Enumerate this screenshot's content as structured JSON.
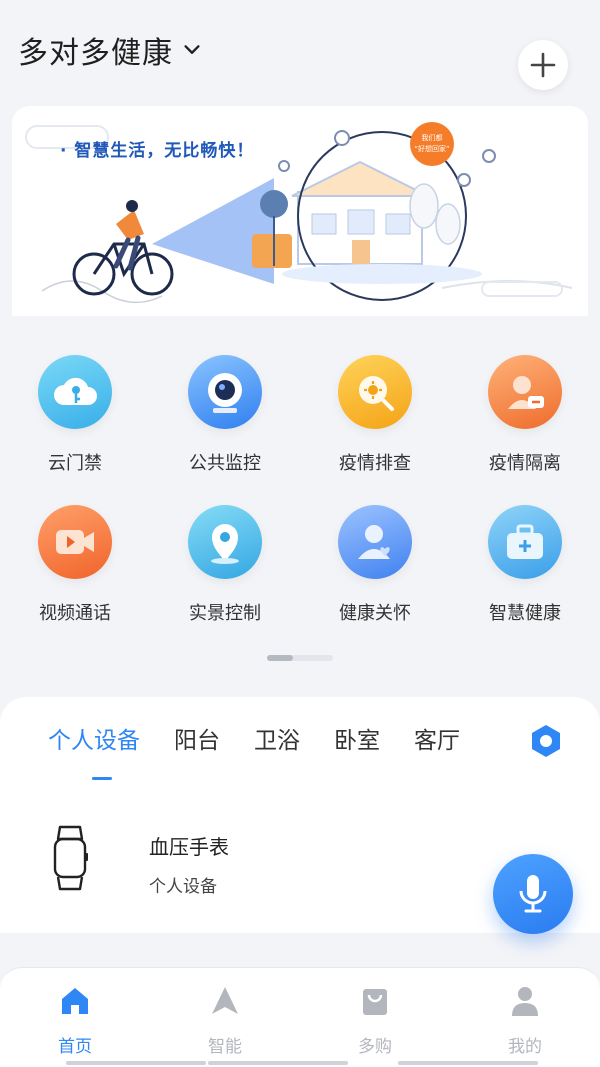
{
  "header": {
    "home_name": "多对多健康"
  },
  "banner": {
    "slogan": "· 智慧生活，无比畅快！",
    "bubble_text": "我们都“好想回家”"
  },
  "services": [
    {
      "label": "云门禁",
      "icon": "cloud-key-icon",
      "color": "#4cc2ef"
    },
    {
      "label": "公共监控",
      "icon": "camera-icon",
      "color": "#3b8ff2"
    },
    {
      "label": "疫情排查",
      "icon": "virus-search-icon",
      "color": "#f8b21d"
    },
    {
      "label": "疫情隔离",
      "icon": "person-quarantine-icon",
      "color": "#f4823c"
    },
    {
      "label": "视频通话",
      "icon": "video-call-icon",
      "color": "#f4823c"
    },
    {
      "label": "实景控制",
      "icon": "location-pin-icon",
      "color": "#3fb6e9"
    },
    {
      "label": "健康关怀",
      "icon": "person-heart-icon",
      "color": "#4b8ff2"
    },
    {
      "label": "智慧健康",
      "icon": "medical-kit-icon",
      "color": "#4db3ec"
    }
  ],
  "rooms": {
    "tabs": [
      "个人设备",
      "阳台",
      "卫浴",
      "卧室",
      "客厅"
    ],
    "active_index": 0
  },
  "devices": [
    {
      "name": "血压手表",
      "room": "个人设备",
      "icon": "watch-icon"
    }
  ],
  "nav": {
    "items": [
      {
        "label": "首页",
        "icon": "home-icon"
      },
      {
        "label": "智能",
        "icon": "navigation-arrow-icon"
      },
      {
        "label": "多购",
        "icon": "shopping-bag-icon"
      },
      {
        "label": "我的",
        "icon": "user-icon"
      }
    ],
    "active_index": 0
  },
  "colors": {
    "accent": "#2f86f5",
    "inactive": "#b3b6bd"
  }
}
